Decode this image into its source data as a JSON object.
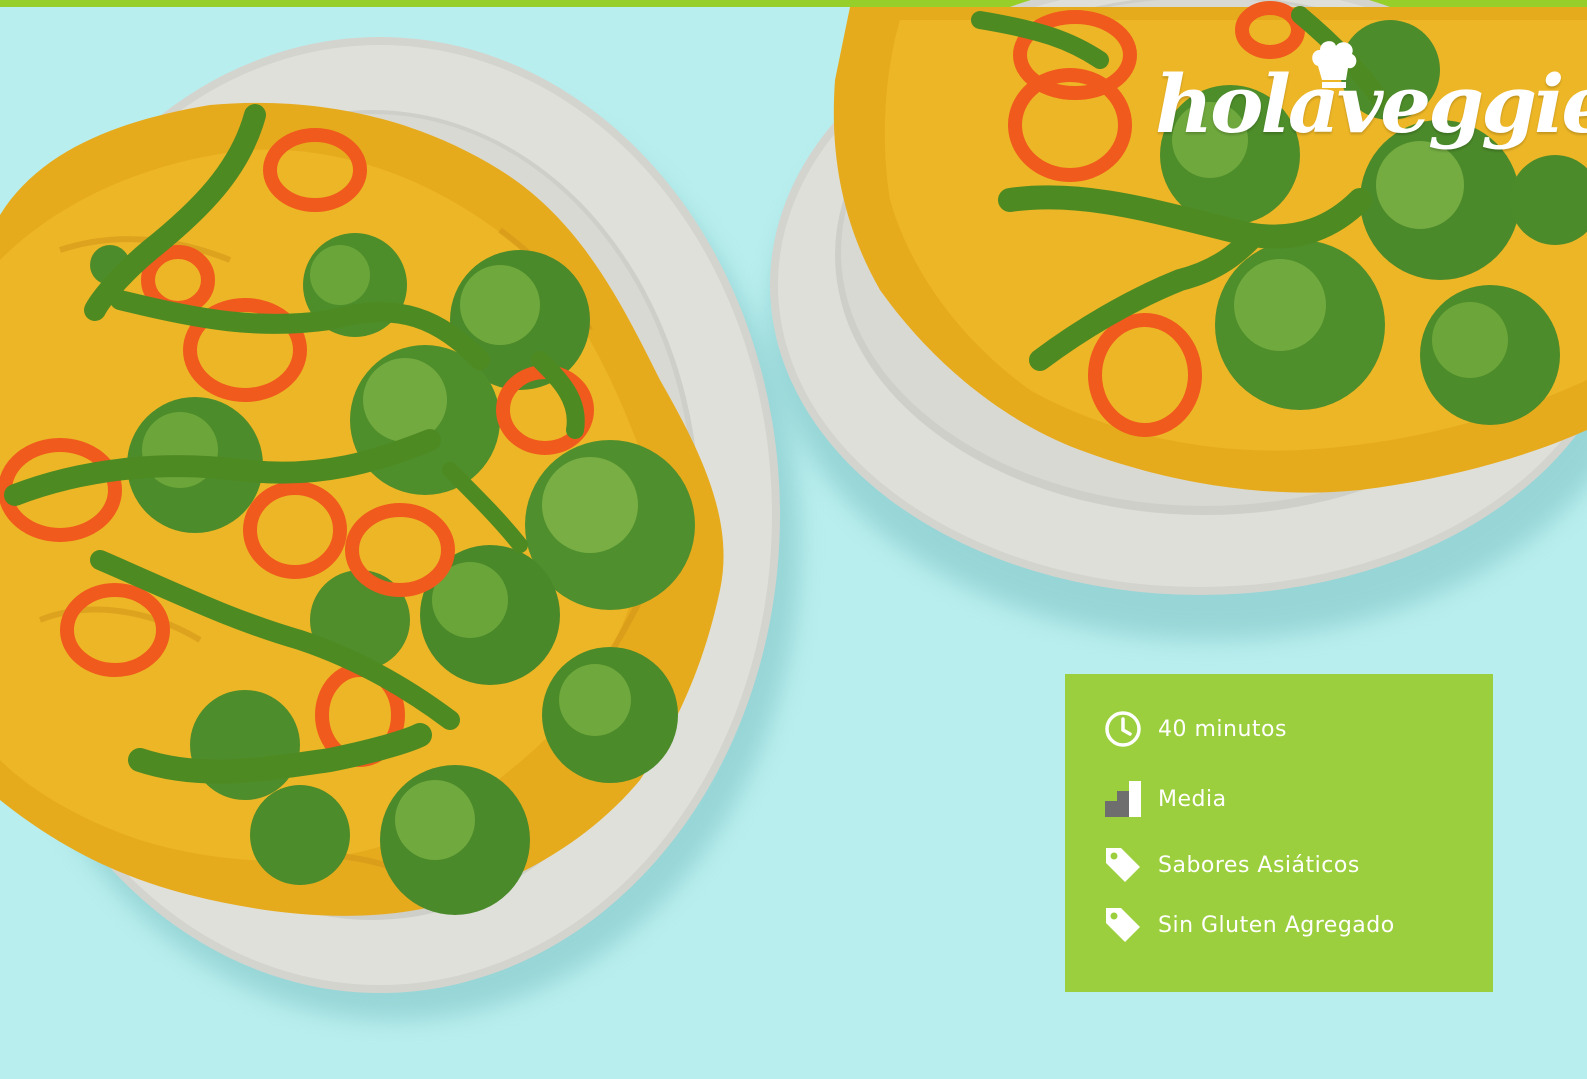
{
  "brand": {
    "logo_text": "holaveggie",
    "logo_icon": "chef-hat-icon"
  },
  "recipe_info": {
    "time_label": "40 minutos",
    "time_icon": "clock-icon",
    "difficulty_label": "Media",
    "difficulty_icon": "difficulty-bars-icon",
    "tags": [
      {
        "label": "Sabores Asiáticos",
        "icon": "tag-icon"
      },
      {
        "label": "Sin Gluten Agregado",
        "icon": "tag-icon"
      }
    ]
  },
  "colors": {
    "background": "#b9eeee",
    "accent_green": "#9ccf3d",
    "top_bar": "#97cf2a",
    "plate": "#dcdcd6",
    "curry": "#e8ad1f",
    "broccoli": "#4f8f2c",
    "pepper": "#f05a1d"
  }
}
